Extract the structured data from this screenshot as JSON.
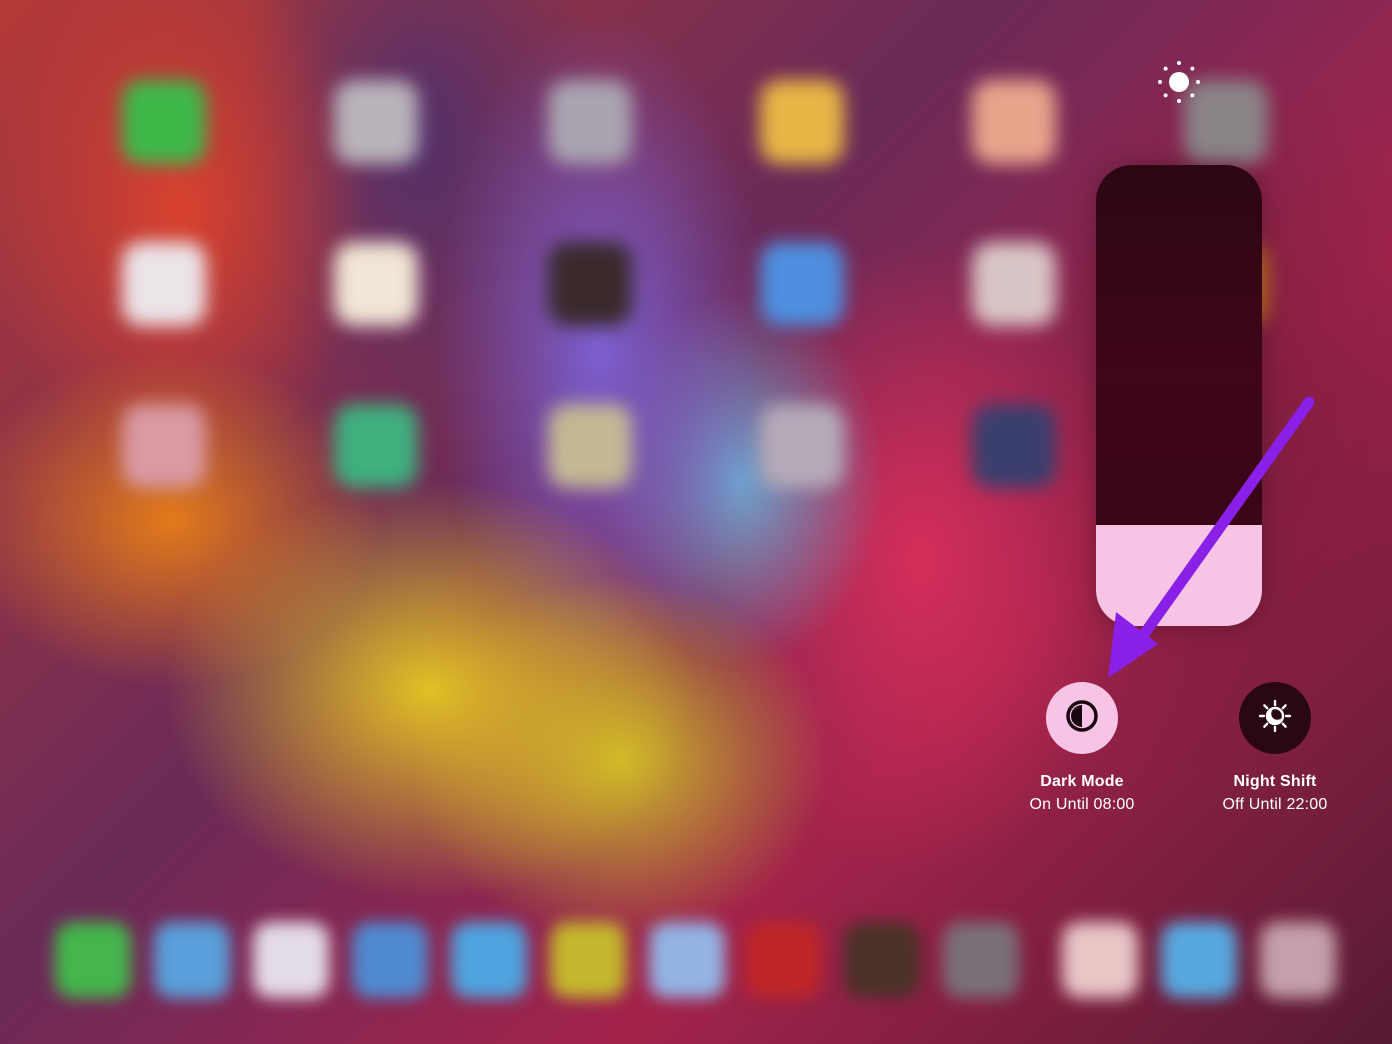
{
  "brightness": {
    "icon": "sun-brightness-icon",
    "level_percent": 22
  },
  "toggles": [
    {
      "id": "dark-mode",
      "title": "Dark Mode",
      "subtitle": "On Until 08:00",
      "icon": "dark-mode-icon",
      "state": "on",
      "circle_color": "#f8c4e5",
      "glyph_color": "#1a0610"
    },
    {
      "id": "night-shift",
      "title": "Night Shift",
      "subtitle": "Off Until 22:00",
      "icon": "night-shift-icon",
      "state": "off",
      "circle_color": "#2a0714",
      "glyph_color": "#ffffff"
    }
  ],
  "annotation": {
    "icon": "pointer-arrow-icon",
    "color": "#8a1fe8"
  },
  "colors": {
    "slider_fill": "#f8c4e5",
    "slider_track": "#360516"
  },
  "home_screen": {
    "app_rows": [
      [
        "#3fb84a",
        "#b9b3ba",
        "#a9a4b0",
        "#e6b646",
        "#e9a48c",
        "#8a8488"
      ],
      [
        "#ece5ea",
        "#f2e6d6",
        "#3a2a2c",
        "#4f8fe0",
        "#d9c5c5",
        "#c07020"
      ],
      [
        "#d99aa4",
        "#3fb07e",
        "#c5b894",
        "#b5aab8",
        "#3a3f6e"
      ]
    ],
    "dock_icons": [
      "#44b64c",
      "#5aa0dc",
      "#e4dce8",
      "#4f8ad0",
      "#4fa4e0",
      "#c4b62e",
      "#93b3e4",
      "#c02628",
      "#4a3228",
      "#7a7078",
      "#e8c6c6",
      "#58a8e0",
      "#c4a0aa"
    ]
  }
}
